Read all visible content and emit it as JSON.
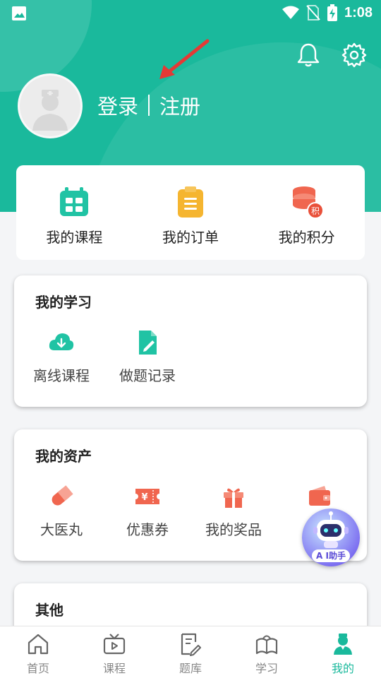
{
  "status": {
    "time": "1:08"
  },
  "header": {
    "login": "登录",
    "register": "注册"
  },
  "quick": [
    {
      "label": "我的课程",
      "icon": "calendar-icon",
      "color": "#20c3a4"
    },
    {
      "label": "我的订单",
      "icon": "order-icon",
      "color": "#f5b530"
    },
    {
      "label": "我的积分",
      "icon": "points-icon",
      "color": "#f0664f",
      "badge": "积"
    }
  ],
  "study": {
    "title": "我的学习",
    "items": [
      {
        "label": "离线课程",
        "icon": "cloud-download-icon"
      },
      {
        "label": "做题记录",
        "icon": "exercise-record-icon"
      }
    ]
  },
  "assets": {
    "title": "我的资产",
    "items": [
      {
        "label": "大医丸",
        "icon": "pill-icon"
      },
      {
        "label": "优惠券",
        "icon": "coupon-icon",
        "coupon_mark": "¥"
      },
      {
        "label": "我的奖品",
        "icon": "gift-icon"
      },
      {
        "label": "我",
        "icon": "wallet-icon"
      }
    ]
  },
  "ai": {
    "label": "A I助手"
  },
  "other": {
    "title": "其他"
  },
  "nav": [
    {
      "label": "首页",
      "icon": "home-icon"
    },
    {
      "label": "课程",
      "icon": "tv-icon"
    },
    {
      "label": "题库",
      "icon": "question-bank-icon"
    },
    {
      "label": "学习",
      "icon": "book-icon"
    },
    {
      "label": "我的",
      "icon": "profile-icon",
      "active": true
    }
  ],
  "colors": {
    "brand": "#1ab99c",
    "icon_red": "#f0664f"
  }
}
